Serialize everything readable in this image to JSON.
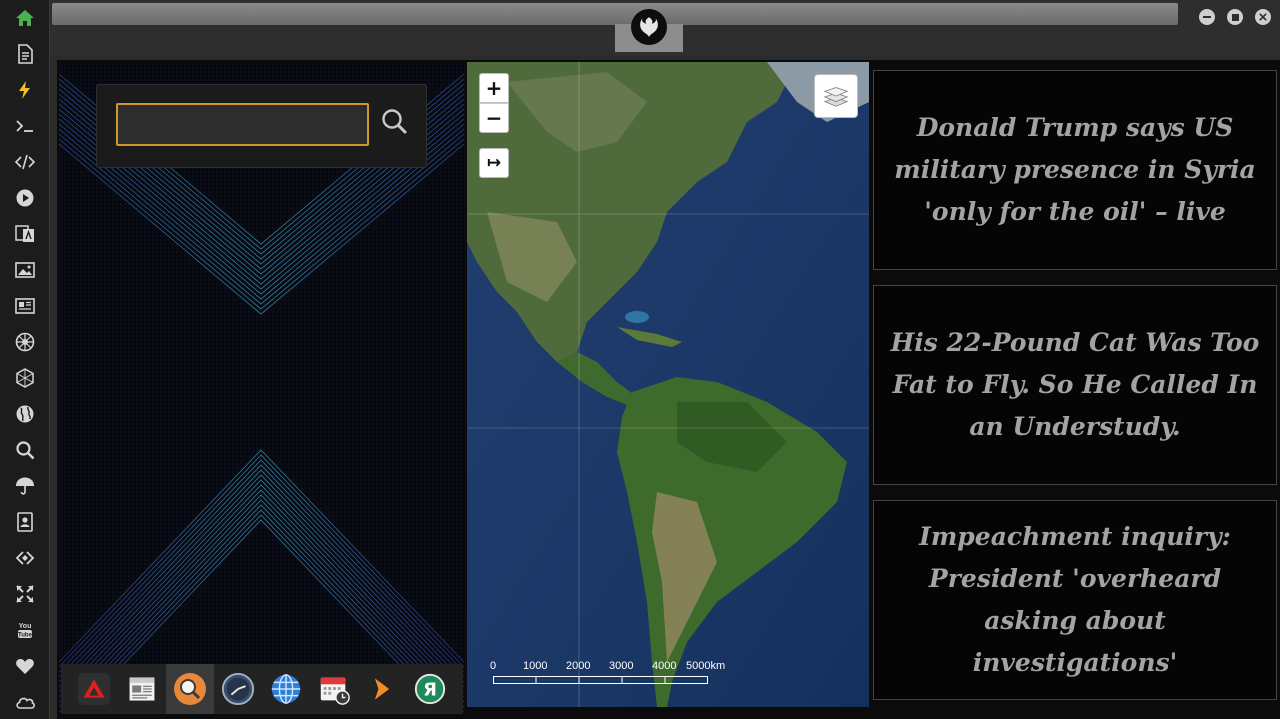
{
  "sidebar": {
    "items": [
      {
        "icon": "home-icon",
        "name": "home"
      },
      {
        "icon": "document-icon",
        "name": "documents"
      },
      {
        "icon": "lightning-icon",
        "name": "power"
      },
      {
        "icon": "terminal-icon",
        "name": "terminal"
      },
      {
        "icon": "code-icon",
        "name": "code"
      },
      {
        "icon": "play-icon",
        "name": "media-player"
      },
      {
        "icon": "translate-icon",
        "name": "translate"
      },
      {
        "icon": "image-icon",
        "name": "images"
      },
      {
        "icon": "newspaper-icon",
        "name": "news"
      },
      {
        "icon": "rebel-alliance-icon",
        "name": "rebel"
      },
      {
        "icon": "hexagon-network-icon",
        "name": "network"
      },
      {
        "icon": "globe-icon",
        "name": "globe"
      },
      {
        "icon": "search-icon",
        "name": "search"
      },
      {
        "icon": "umbrella-icon",
        "name": "weather"
      },
      {
        "icon": "contacts-icon",
        "name": "contacts"
      },
      {
        "icon": "link-icon",
        "name": "links"
      },
      {
        "icon": "expand-icon",
        "name": "fullscreen"
      },
      {
        "icon": "youtube-icon",
        "name": "youtube"
      },
      {
        "icon": "heart-icon",
        "name": "favorites"
      },
      {
        "icon": "cloud-icon",
        "name": "cloud"
      }
    ],
    "active_color": "#4caf50",
    "accent_color": "#f0c419"
  },
  "window": {
    "logo": "rebel-alliance-icon",
    "controls": [
      "minimize",
      "maximize",
      "close"
    ]
  },
  "search": {
    "value": "",
    "placeholder": "",
    "border_color": "#d1952c"
  },
  "dock": {
    "items": [
      {
        "name": "anydesk",
        "icon": "red-triangle-icon"
      },
      {
        "name": "news-reader",
        "icon": "newspaper-icon"
      },
      {
        "name": "search",
        "icon": "magnifier-icon",
        "active": true
      },
      {
        "name": "clock",
        "icon": "clock-icon"
      },
      {
        "name": "browser",
        "icon": "globe-icon"
      },
      {
        "name": "calendar",
        "icon": "calendar-icon"
      },
      {
        "name": "launcher",
        "icon": "chevron-right-icon"
      },
      {
        "name": "yandex",
        "icon": "yandex-icon"
      }
    ]
  },
  "map": {
    "zoom_in": "+",
    "zoom_out": "−",
    "fit": "↦",
    "layers_icon": "layers-icon",
    "scale_labels": [
      "0",
      "1000",
      "2000",
      "3000",
      "4000",
      "5000km"
    ]
  },
  "news": [
    {
      "headline": "Donald Trump says US military presence in Syria 'only for the oil' – live"
    },
    {
      "headline": "His 22-Pound Cat Was Too Fat to Fly. So He Called In an Understudy."
    },
    {
      "headline": "Impeachment inquiry: President 'overheard asking about investigations'"
    }
  ]
}
